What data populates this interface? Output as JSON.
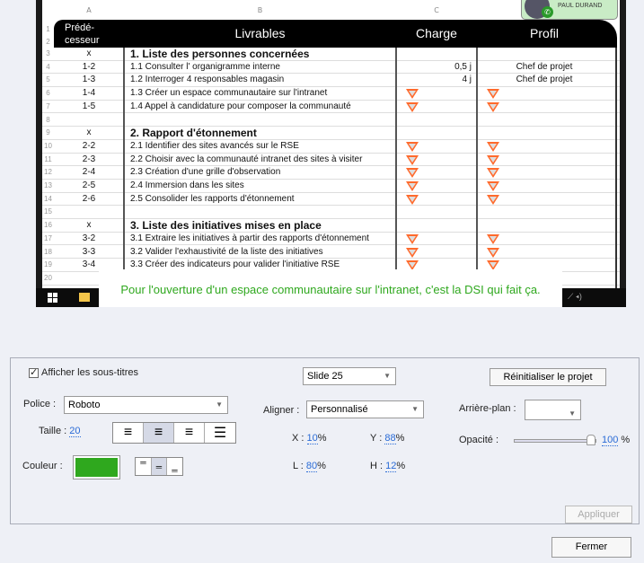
{
  "sheet": {
    "col_headers": [
      "A",
      "B",
      "C"
    ],
    "header": {
      "pred": "Prédé-\ncesseur",
      "livrables": "Livrables",
      "charge": "Charge",
      "profil": "Profil"
    },
    "rows": [
      {
        "n": "3",
        "pred": "x",
        "task": "1. Liste des personnes concernées",
        "bold": true
      },
      {
        "n": "4",
        "pred": "1-2",
        "task": "1.1 Consulter l' organigramme interne",
        "charge": "0,5 j",
        "profil": "Chef de projet"
      },
      {
        "n": "5",
        "pred": "1-3",
        "task": "1.2 Interroger 4 responsables magasin",
        "charge": "4 j",
        "profil": "Chef de projet"
      },
      {
        "n": "6",
        "pred": "1-4",
        "task": "1.3 Créer un espace communautaire sur l'intranet",
        "tri": true
      },
      {
        "n": "7",
        "pred": "1-5",
        "task": "1.4 Appel à candidature pour composer la communauté",
        "tri": true
      },
      {
        "n": "8"
      },
      {
        "n": "9",
        "pred": "x",
        "task": "2. Rapport d'étonnement",
        "bold": true
      },
      {
        "n": "10",
        "pred": "2-2",
        "task": "2.1 Identifier des sites avancés sur le RSE",
        "tri": true
      },
      {
        "n": "11",
        "pred": "2-3",
        "task": "2.2 Choisir avec la communauté intranet des sites à visiter",
        "tri": true
      },
      {
        "n": "12",
        "pred": "2-4",
        "task": "2.3 Création d'une grille d'observation",
        "tri": true
      },
      {
        "n": "13",
        "pred": "2-5",
        "task": "2.4 Immersion dans les sites",
        "tri": true
      },
      {
        "n": "14",
        "pred": "2-6",
        "task": "2.5 Consolider les rapports d'étonnement",
        "tri": true
      },
      {
        "n": "15"
      },
      {
        "n": "16",
        "pred": "x",
        "task": "3. Liste des initiatives mises en place",
        "bold": true
      },
      {
        "n": "17",
        "pred": "3-2",
        "task": "3.1 Extraire les initiatives à partir des rapports d'étonnement",
        "tri": true
      },
      {
        "n": "18",
        "pred": "3-3",
        "task": "3.2 Valider l'exhaustivité de la liste des initiatives",
        "tri": true
      },
      {
        "n": "19",
        "pred": "3-4",
        "task": "3.3 Créer des indicateurs pour valider l'initiative RSE",
        "tri": true
      },
      {
        "n": "20"
      }
    ]
  },
  "caller": {
    "name": "PAUL DURAND"
  },
  "subtitle": "Pour l'ouverture d'un espace communautaire sur l'intranet, c'est la DSI qui fait ça.",
  "panel": {
    "show_subtitles": "Afficher les sous-titres",
    "show_subtitles_checked": true,
    "slide": "Slide 25",
    "reset": "Réinitialiser le projet",
    "font_label": "Police :",
    "font": "Roboto",
    "size_label": "Taille :",
    "size": "20",
    "color_label": "Couleur :",
    "color": "#2fa81e",
    "align_label": "Aligner :",
    "align": "Personnalisé",
    "x_label": "X :",
    "x": "10",
    "y_label": "Y :",
    "y": "88",
    "l_label": "L :",
    "l": "80",
    "h_label": "H :",
    "h": "12",
    "pct": "%",
    "bg_label": "Arrière-plan :",
    "opacity_label": "Opacité :",
    "opacity": "100",
    "text_align_active": "center",
    "vertical_align_active": "middle",
    "apply": "Appliquer"
  },
  "close": "Fermer"
}
